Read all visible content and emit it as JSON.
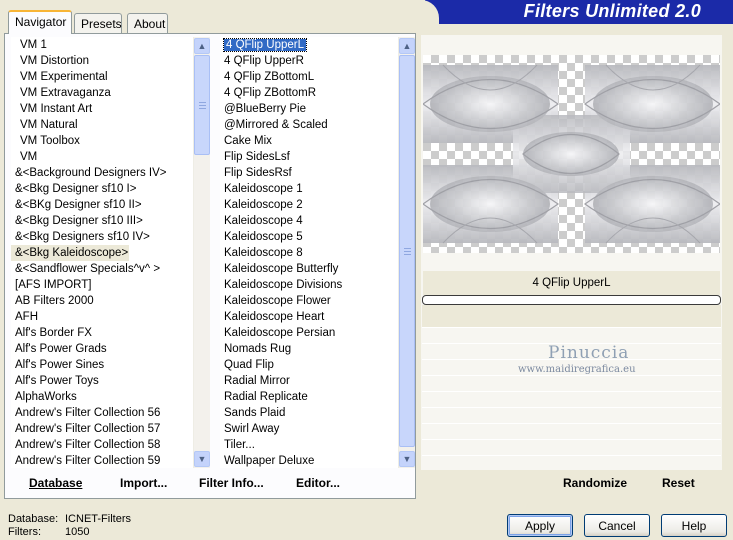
{
  "banner": {
    "title": "Filters Unlimited 2.0"
  },
  "tabs": [
    {
      "label": "Navigator",
      "active": true
    },
    {
      "label": "Presets",
      "active": false
    },
    {
      "label": "About",
      "active": false
    }
  ],
  "categories": {
    "items": [
      "VM 1",
      "VM Distortion",
      "VM Experimental",
      "VM Extravaganza",
      "VM Instant Art",
      "VM Natural",
      "VM Toolbox",
      "VM",
      "&<Background Designers IV>",
      "&<Bkg Designer sf10 I>",
      "&<BKg Designer sf10 II>",
      "&<Bkg Designer sf10 III>",
      "&<Bkg Designers sf10 IV>",
      "&<Bkg Kaleidoscope>",
      "&<Sandflower Specials^v^ >",
      "[AFS IMPORT]",
      "AB Filters 2000",
      "AFH",
      "Alf's Border FX",
      "Alf's Power Grads",
      "Alf's Power Sines",
      "Alf's Power Toys",
      "AlphaWorks",
      "Andrew's Filter Collection 56",
      "Andrew's Filter Collection 57",
      "Andrew's Filter Collection 58",
      "Andrew's Filter Collection 59"
    ],
    "selected": "&<Bkg Kaleidoscope>"
  },
  "filters": {
    "items": [
      "4 QFlip UpperL",
      "4 QFlip UpperR",
      "4 QFlip ZBottomL",
      "4 QFlip ZBottomR",
      "@BlueBerry Pie",
      "@Mirrored & Scaled",
      "Cake Mix",
      "Flip SidesLsf",
      "Flip SidesRsf",
      "Kaleidoscope 1",
      "Kaleidoscope 2",
      "Kaleidoscope 4",
      "Kaleidoscope 5",
      "Kaleidoscope 8",
      "Kaleidoscope Butterfly",
      "Kaleidoscope Divisions",
      "Kaleidoscope Flower",
      "Kaleidoscope Heart",
      "Kaleidoscope Persian",
      "Nomads Rug",
      "Quad Flip",
      "Radial Mirror",
      "Radial Replicate",
      "Sands Plaid",
      "Swirl Away",
      "Tiler...",
      "Wallpaper Deluxe"
    ],
    "selected": "4 QFlip UpperL"
  },
  "bottom_bar": {
    "database_label": "Database",
    "import_label": "Import...",
    "filter_info_label": "Filter Info...",
    "editor_label": "Editor...",
    "randomize_label": "Randomize",
    "reset_label": "Reset"
  },
  "preview": {
    "filter_name": "4 QFlip UpperL",
    "watermark_name": "Pinuccia",
    "watermark_url": "www.maidiregrafica.eu"
  },
  "status": {
    "database_key": "Database:",
    "database_value": "ICNET-Filters",
    "filters_key": "Filters:",
    "filters_value": "1050"
  },
  "dialog_buttons": {
    "apply": "Apply",
    "cancel": "Cancel",
    "help": "Help"
  },
  "colors": {
    "banner_blue": "#1b2aa8",
    "selection_blue": "#316ac5",
    "dialog_bg": "#ece9d8"
  }
}
